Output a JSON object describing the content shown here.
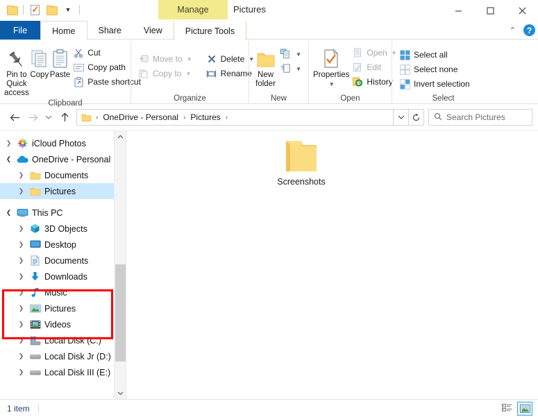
{
  "window": {
    "title": "Pictures",
    "contextual_tab_title": "Manage",
    "minimize_label": "Minimize",
    "maximize_label": "Maximize",
    "close_label": "Close"
  },
  "quick_access_toolbar": {
    "items": [
      {
        "name": "folder-icon",
        "label": "Explorer"
      },
      {
        "name": "properties-icon",
        "label": "Properties"
      },
      {
        "name": "new-folder-icon",
        "label": "New folder"
      },
      {
        "name": "customize-caret-icon",
        "label": "Customize Quick Access Toolbar"
      }
    ]
  },
  "tabs": [
    {
      "id": "file",
      "label": "File",
      "active": false
    },
    {
      "id": "home",
      "label": "Home",
      "active": true
    },
    {
      "id": "share",
      "label": "Share",
      "active": false
    },
    {
      "id": "view",
      "label": "View",
      "active": false
    },
    {
      "id": "picture-tools",
      "label": "Picture Tools",
      "active": false
    }
  ],
  "tabstrip_right": {
    "collapse_label": "⌃",
    "help_label": "?"
  },
  "ribbon": {
    "groups": [
      {
        "id": "clipboard",
        "label": "Clipboard",
        "big_buttons": [
          {
            "name": "pin-to-quick-access-button",
            "label": "Pin to Quick\naccess",
            "line1": "Pin to Quick",
            "line2": "access"
          },
          {
            "name": "copy-button",
            "label": "Copy"
          },
          {
            "name": "paste-button",
            "label": "Paste"
          }
        ],
        "small_buttons": [
          {
            "name": "cut-button",
            "label": "Cut",
            "disabled": false
          },
          {
            "name": "copy-path-button",
            "label": "Copy path",
            "disabled": false
          },
          {
            "name": "paste-shortcut-button",
            "label": "Paste shortcut",
            "disabled": false
          }
        ]
      },
      {
        "id": "organize",
        "label": "Organize",
        "small_buttons_left": [
          {
            "name": "move-to-button",
            "label": "Move to",
            "disabled": true,
            "caret": true
          },
          {
            "name": "copy-to-button",
            "label": "Copy to",
            "disabled": true,
            "caret": true
          }
        ],
        "small_buttons_right": [
          {
            "name": "delete-button",
            "label": "Delete",
            "disabled": false,
            "caret": true
          },
          {
            "name": "rename-button",
            "label": "Rename",
            "disabled": false,
            "caret": false
          }
        ]
      },
      {
        "id": "new",
        "label": "New",
        "big_buttons": [
          {
            "name": "new-folder-button",
            "line1": "New",
            "line2": "folder",
            "label": "New folder"
          }
        ],
        "small_buttons": [
          {
            "name": "new-item-button",
            "label": "",
            "caret": true
          },
          {
            "name": "easy-access-button",
            "label": "",
            "caret": true
          }
        ]
      },
      {
        "id": "open",
        "label": "Open",
        "big_buttons": [
          {
            "name": "properties-button",
            "line1": "Properties",
            "line2": "",
            "label": "Properties"
          }
        ],
        "small_buttons": [
          {
            "name": "open-button",
            "label": "Open",
            "disabled": true,
            "caret": true
          },
          {
            "name": "edit-button",
            "label": "Edit",
            "disabled": true,
            "caret": false
          },
          {
            "name": "history-button",
            "label": "History",
            "disabled": false,
            "caret": false
          }
        ]
      },
      {
        "id": "select",
        "label": "Select",
        "small_buttons": [
          {
            "name": "select-all-button",
            "label": "Select all"
          },
          {
            "name": "select-none-button",
            "label": "Select none"
          },
          {
            "name": "invert-selection-button",
            "label": "Invert selection"
          }
        ]
      }
    ]
  },
  "address_bar": {
    "back_label": "←",
    "forward_label": "→",
    "recent_label": "⌄",
    "up_label": "↑",
    "breadcrumbs": [
      {
        "name": "breadcrumb-onedrive",
        "label": "OneDrive - Personal"
      },
      {
        "name": "breadcrumb-pictures",
        "label": "Pictures"
      }
    ],
    "dropdown_label": "⌄",
    "refresh_label": "↻",
    "search_placeholder": "Search Pictures",
    "search_value": ""
  },
  "sidebar": {
    "items": [
      {
        "name": "sidebar-item-icloud-photos",
        "label": "iCloud Photos",
        "icon": "icloud-photos-icon",
        "indent": 1,
        "expanded": false,
        "selected": false,
        "chevron": "collapsed"
      },
      {
        "name": "sidebar-item-onedrive-personal",
        "label": "OneDrive - Personal",
        "icon": "onedrive-icon",
        "indent": 1,
        "expanded": true,
        "selected": false,
        "chevron": "expanded"
      },
      {
        "name": "sidebar-item-documents-onedrive",
        "label": "Documents",
        "icon": "folder-icon",
        "indent": 2,
        "expanded": false,
        "selected": false,
        "chevron": "collapsed"
      },
      {
        "name": "sidebar-item-pictures-onedrive",
        "label": "Pictures",
        "icon": "folder-icon",
        "indent": 2,
        "expanded": false,
        "selected": true,
        "chevron": "collapsed"
      },
      {
        "name": "sidebar-item-this-pc",
        "label": "This PC",
        "icon": "this-pc-icon",
        "indent": 1,
        "expanded": true,
        "selected": false,
        "chevron": "expanded"
      },
      {
        "name": "sidebar-item-3d-objects",
        "label": "3D Objects",
        "icon": "3d-objects-icon",
        "indent": 2,
        "expanded": false,
        "selected": false,
        "chevron": "collapsed"
      },
      {
        "name": "sidebar-item-desktop",
        "label": "Desktop",
        "icon": "desktop-icon",
        "indent": 2,
        "expanded": false,
        "selected": false,
        "chevron": "collapsed"
      },
      {
        "name": "sidebar-item-documents",
        "label": "Documents",
        "icon": "documents-icon",
        "indent": 2,
        "expanded": false,
        "selected": false,
        "chevron": "collapsed"
      },
      {
        "name": "sidebar-item-downloads",
        "label": "Downloads",
        "icon": "downloads-icon",
        "indent": 2,
        "expanded": false,
        "selected": false,
        "chevron": "collapsed"
      },
      {
        "name": "sidebar-item-music",
        "label": "Music",
        "icon": "music-icon",
        "indent": 2,
        "expanded": false,
        "selected": false,
        "chevron": "collapsed"
      },
      {
        "name": "sidebar-item-pictures",
        "label": "Pictures",
        "icon": "pictures-icon",
        "indent": 2,
        "expanded": false,
        "selected": false,
        "chevron": "collapsed"
      },
      {
        "name": "sidebar-item-videos",
        "label": "Videos",
        "icon": "videos-icon",
        "indent": 2,
        "expanded": false,
        "selected": false,
        "chevron": "collapsed"
      },
      {
        "name": "sidebar-item-local-disk-c",
        "label": "Local Disk (C:)",
        "icon": "system-drive-icon",
        "indent": 2,
        "expanded": false,
        "selected": false,
        "chevron": "collapsed"
      },
      {
        "name": "sidebar-item-local-disk-d",
        "label": "Local Disk Jr (D:)",
        "icon": "drive-icon",
        "indent": 2,
        "expanded": false,
        "selected": false,
        "chevron": "collapsed"
      },
      {
        "name": "sidebar-item-local-disk-e",
        "label": "Local Disk III (E:)",
        "icon": "drive-icon",
        "indent": 2,
        "expanded": false,
        "selected": false,
        "chevron": "collapsed"
      }
    ],
    "highlight": {
      "name": "red-annotation-box",
      "color": "#fe0000",
      "covers": "OneDrive - Personal, Documents, Pictures"
    },
    "scrollbar": {
      "up_label": "⌃",
      "down_label": "⌄"
    }
  },
  "content": {
    "files": [
      {
        "name": "file-item-screenshots",
        "label": "Screenshots",
        "type": "folder"
      }
    ]
  },
  "status_bar": {
    "item_count": "1 item",
    "view_buttons": [
      {
        "name": "details-view-button",
        "label": "Details view",
        "active": false
      },
      {
        "name": "large-icons-view-button",
        "label": "Large icons view",
        "active": true
      }
    ]
  },
  "colors": {
    "file_tab_blue": "#0b5ca8",
    "contextual_yellow": "#f2ea8c",
    "selection_blue": "#cce8ff",
    "annotation_red": "#fe0000",
    "folder_yellow": "#fcd975"
  }
}
